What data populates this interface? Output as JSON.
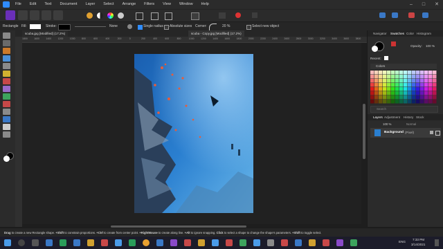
{
  "menu": [
    "File",
    "Edit",
    "Text",
    "Document",
    "Layer",
    "Select",
    "Arrange",
    "Filters",
    "View",
    "Window",
    "Help"
  ],
  "context": {
    "tool_name": "Rectangle",
    "fill_label": "Fill:",
    "stroke_label": "Stroke:",
    "stroke_value": "None",
    "single_radius": "Single radius",
    "absolute_sizes": "Absolute sizes",
    "corner_label": "Corner:",
    "corner_value": "20 %",
    "select_new_object": "Select new object"
  },
  "tabs": [
    "scuba.jpg [Modified] (17.2%)",
    "scuba - Copy.jpg [Modified] (17.2%)"
  ],
  "ruler_marks": [
    "1800",
    "1600",
    "1400",
    "1200",
    "1000",
    "800",
    "600",
    "400",
    "200",
    "0",
    "200",
    "400",
    "600",
    "800",
    "1000",
    "1200",
    "1400",
    "1600",
    "1800",
    "2000",
    "2200",
    "2400",
    "2600",
    "2800",
    "3000",
    "3200",
    "3400",
    "3600",
    "3800"
  ],
  "panel": {
    "tabs_top": [
      "Navigator",
      "Swatches",
      "Color",
      "Histogram"
    ],
    "opacity_label": "Opacity:",
    "opacity_value": "100 %",
    "recent_label": "Recent:",
    "palette_name": "Colors",
    "search_placeholder": "Search",
    "tabs_layers": [
      "Layers",
      "Adjustment",
      "History",
      "Stock"
    ],
    "layer_opacity": "100 %",
    "blend_mode": "Normal",
    "layer_name": "Background",
    "layer_type": "(Pixel)"
  },
  "status": {
    "parts": [
      {
        "bold": "Drag",
        "text": " to create a new Rectangle shape. "
      },
      {
        "bold": "+Shift",
        "text": " to constrain proportions. "
      },
      {
        "bold": "+Ctrl",
        "text": " to create from center point. "
      },
      {
        "bold": "+RightMouse",
        "text": " to create along line. "
      },
      {
        "bold": "+Alt",
        "text": " to ignore snapping. "
      },
      {
        "bold": "Click",
        "text": " to select a shape to change the shape's parameters. "
      },
      {
        "bold": "+Shift",
        "text": " to toggle select."
      }
    ]
  },
  "taskbar": {
    "lang": "ENG",
    "time": "7:33 PM",
    "date": "3/14/2021"
  },
  "colors": {
    "accent": "#2f8cff",
    "bg": "#1e1e1e",
    "panel": "#2b2b2b"
  }
}
